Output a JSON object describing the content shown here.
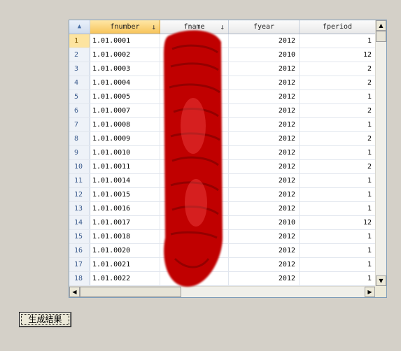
{
  "grid": {
    "corner_icon": "lock-icon",
    "columns": [
      {
        "label": "fnumber",
        "sort_icon": "↓"
      },
      {
        "label": "fname",
        "sort_icon": "↓"
      },
      {
        "label": "fyear"
      },
      {
        "label": "fperiod"
      }
    ],
    "rows": [
      {
        "n": "1",
        "fnumber": "1.01.0001",
        "fname": "",
        "fyear": "2012",
        "fperiod": "1"
      },
      {
        "n": "2",
        "fnumber": "1.01.0002",
        "fname": "",
        "fyear": "2010",
        "fperiod": "12"
      },
      {
        "n": "3",
        "fnumber": "1.01.0003",
        "fname": "",
        "fyear": "2012",
        "fperiod": "2"
      },
      {
        "n": "4",
        "fnumber": "1.01.0004",
        "fname": "",
        "fyear": "2012",
        "fperiod": "2"
      },
      {
        "n": "5",
        "fnumber": "1.01.0005",
        "fname": "",
        "fyear": "2012",
        "fperiod": "1"
      },
      {
        "n": "6",
        "fnumber": "1.01.0007",
        "fname": "",
        "fyear": "2012",
        "fperiod": "2"
      },
      {
        "n": "7",
        "fnumber": "1.01.0008",
        "fname": "",
        "fyear": "2012",
        "fperiod": "1"
      },
      {
        "n": "8",
        "fnumber": "1.01.0009",
        "fname": "",
        "fyear": "2012",
        "fperiod": "2"
      },
      {
        "n": "9",
        "fnumber": "1.01.0010",
        "fname": "",
        "fyear": "2012",
        "fperiod": "1"
      },
      {
        "n": "10",
        "fnumber": "1.01.0011",
        "fname": "",
        "fyear": "2012",
        "fperiod": "2"
      },
      {
        "n": "11",
        "fnumber": "1.01.0014",
        "fname": "",
        "fyear": "2012",
        "fperiod": "1"
      },
      {
        "n": "12",
        "fnumber": "1.01.0015",
        "fname": "",
        "fyear": "2012",
        "fperiod": "1"
      },
      {
        "n": "13",
        "fnumber": "1.01.0016",
        "fname": "",
        "fyear": "2012",
        "fperiod": "1"
      },
      {
        "n": "14",
        "fnumber": "1.01.0017",
        "fname": "",
        "fyear": "2010",
        "fperiod": "12"
      },
      {
        "n": "15",
        "fnumber": "1.01.0018",
        "fname": "",
        "fyear": "2012",
        "fperiod": "1"
      },
      {
        "n": "16",
        "fnumber": "1.01.0020",
        "fname": "",
        "fyear": "2012",
        "fperiod": "1"
      },
      {
        "n": "17",
        "fnumber": "1.01.0021",
        "fname": "",
        "fyear": "2012",
        "fperiod": "1"
      },
      {
        "n": "18",
        "fnumber": "1.01.0022",
        "fname": "",
        "fyear": "2012",
        "fperiod": "1"
      }
    ],
    "scroll_icons": {
      "up": "▲",
      "down": "▼",
      "left": "◀",
      "right": "▶"
    }
  },
  "actions": {
    "generate_label": "生成結果"
  },
  "colors": {
    "background": "#d4d0c8",
    "selected_header": "#f7c45a",
    "redaction": "#c00000"
  }
}
